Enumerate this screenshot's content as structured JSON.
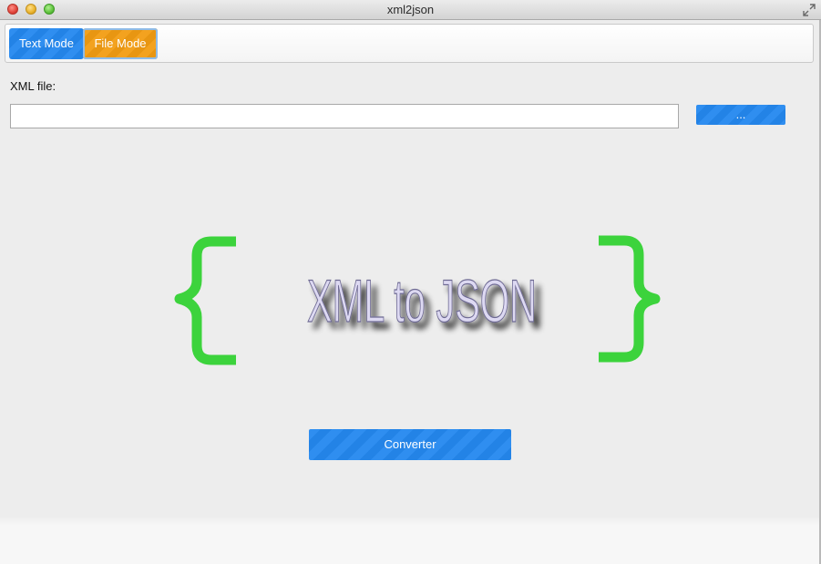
{
  "window": {
    "title": "xml2json"
  },
  "modes": {
    "text_mode_label": "Text Mode",
    "file_mode_label": "File Mode",
    "active": "File Mode"
  },
  "file_section": {
    "label": "XML file:",
    "input_value": "",
    "browse_label": "..."
  },
  "logo": {
    "left_brace": "{",
    "text": "XML to JSON",
    "right_brace": "}",
    "brace_color": "#3cd33c"
  },
  "actions": {
    "convert_label": "Converter"
  },
  "colors": {
    "primary_button": "#2383e6",
    "active_mode": "#e89612"
  }
}
